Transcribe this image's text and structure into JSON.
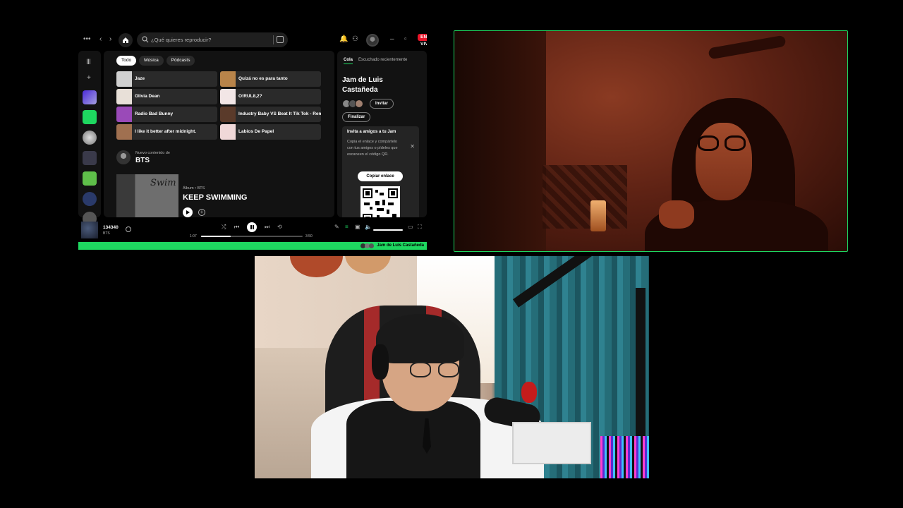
{
  "spotify": {
    "search": {
      "placeholder": "¿Qué quieres reproducir?"
    },
    "live_badge": "EN VIVO",
    "filter_chips": [
      "Todo",
      "Música",
      "Pódcasts"
    ],
    "quick_picks": [
      {
        "label": "Jaze",
        "color": "#d0d0d0"
      },
      {
        "label": "Quizá no es para tanto",
        "color": "#b8844a"
      },
      {
        "label": "Olivia Dean",
        "color": "#e8e0d8"
      },
      {
        "label": "O!RUL8,2?",
        "color": "#f2e6e6"
      },
      {
        "label": "Radio Bad Bunny",
        "color": "#9a4ab8"
      },
      {
        "label": "Industry Baby VS Beat It Tik Tok - Remix",
        "color": "#5a3a2a"
      },
      {
        "label": "I like it better after midnight.",
        "color": "#a07050"
      },
      {
        "label": "Labios De Papel",
        "color": "#f0d8d8"
      }
    ],
    "new_content": {
      "subtitle": "Nuevo contenido de",
      "artist": "BTS"
    },
    "album": {
      "art_text": "Swim",
      "meta": "Álbum • BTS",
      "title": "KEEP SWIMMING"
    },
    "right_panel": {
      "tabs": [
        "Cola",
        "Escuchado recientemente"
      ],
      "jam_title": "Jam de Luis Castañeda",
      "invite_button": "Invitar",
      "finish_button": "Finalizar",
      "invite_card": {
        "title": "Invita a amigos a tu Jam",
        "body": "Copia el enlace y compártelo con tus amigos o pídeles que escaneen el código QR.",
        "copy_button": "Copiar enlace"
      }
    },
    "player": {
      "track_title": "134340",
      "track_artist": "BTS",
      "elapsed": "1:07",
      "duration": "3:50",
      "progress_fraction": 0.29,
      "volume_fraction": 1.0
    },
    "jam_bar": {
      "label": "Jam de Luis Castañeda",
      "accent": "#1ed760"
    }
  },
  "colors": {
    "accent": "#1ed760",
    "live": "#e91429",
    "background": "#121212"
  }
}
